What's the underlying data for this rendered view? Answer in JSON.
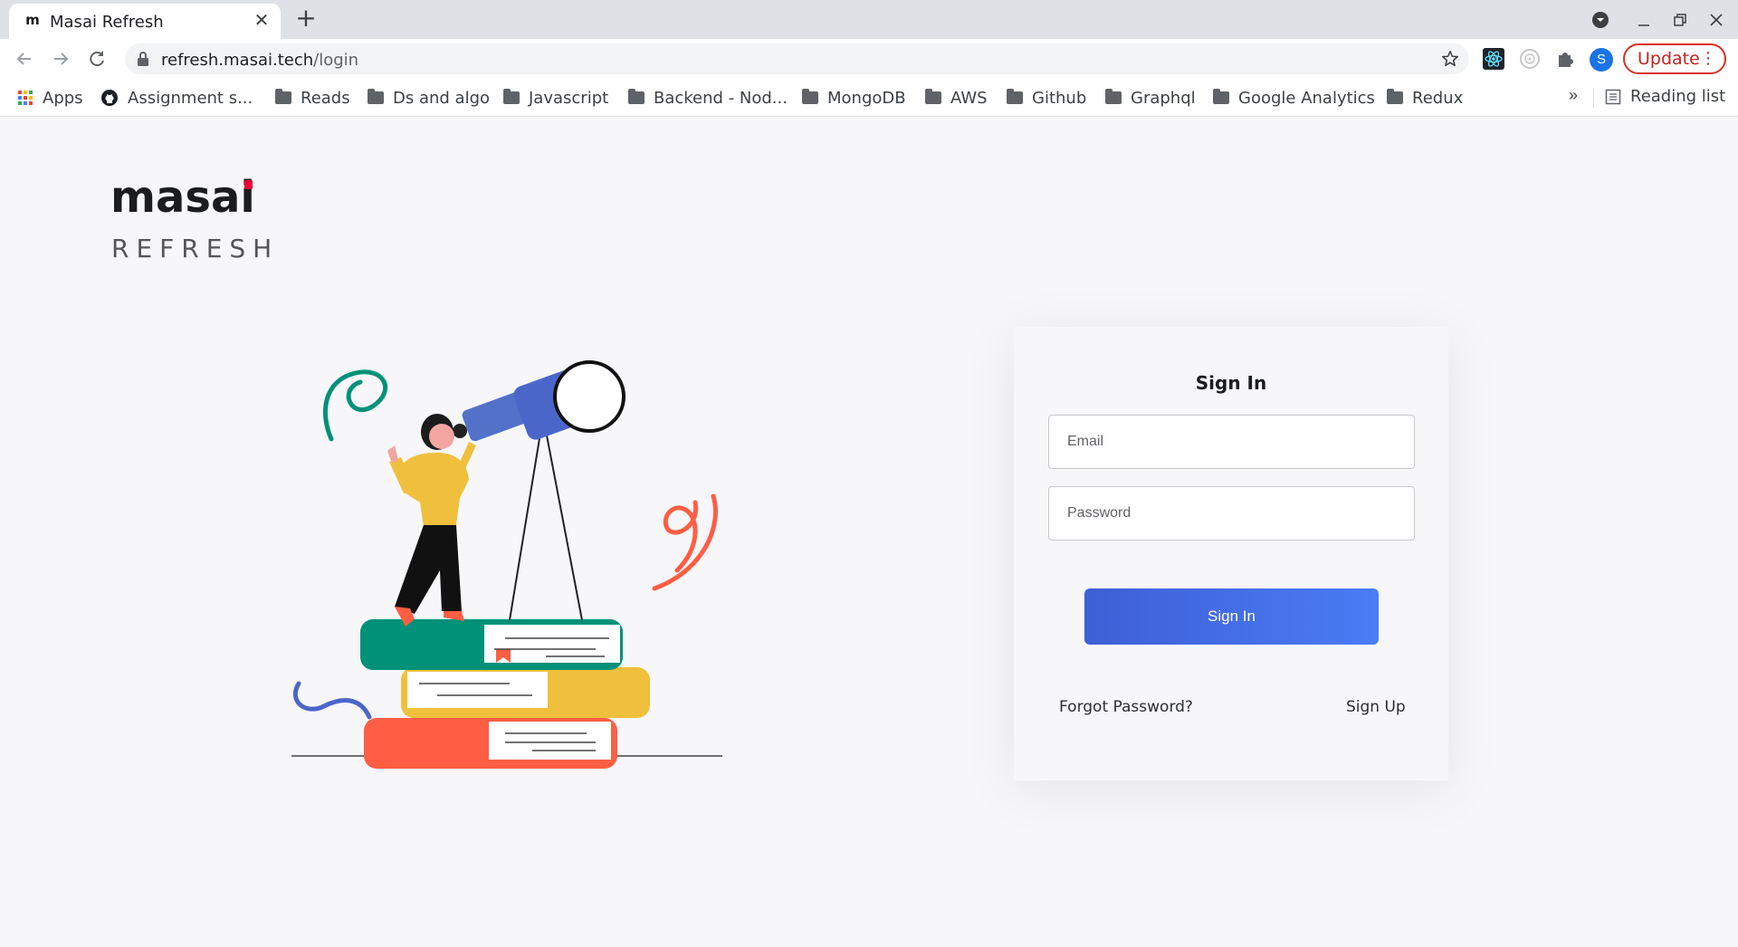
{
  "tab": {
    "favicon": "m",
    "title": "Masai Refresh",
    "close": "✕"
  },
  "new_tab": "+",
  "address": {
    "host": "refresh.masai.tech",
    "path": "/login"
  },
  "profile_initial": "S",
  "update_label": "Update",
  "bookmarks": {
    "apps": "Apps",
    "items": [
      "Assignment s...",
      "Reads",
      "Ds and algo",
      "Javascript",
      "Backend - Nod...",
      "MongoDB",
      "AWS",
      "Github",
      "Graphql",
      "Google Analytics",
      "Redux"
    ],
    "more": "»",
    "reading_list": "Reading list"
  },
  "logo": {
    "word": "masai",
    "sub": "REFRESH",
    "accent": "#ed0331"
  },
  "signin": {
    "title": "Sign In",
    "email_placeholder": "Email",
    "password_placeholder": "Password",
    "button": "Sign In",
    "forgot": "Forgot Password?",
    "signup": "Sign Up"
  },
  "colors": {
    "button": "#4467e6",
    "books": [
      "#009178",
      "#f0c03d",
      "#fe5e44"
    ],
    "telescope": "#5271c9"
  }
}
